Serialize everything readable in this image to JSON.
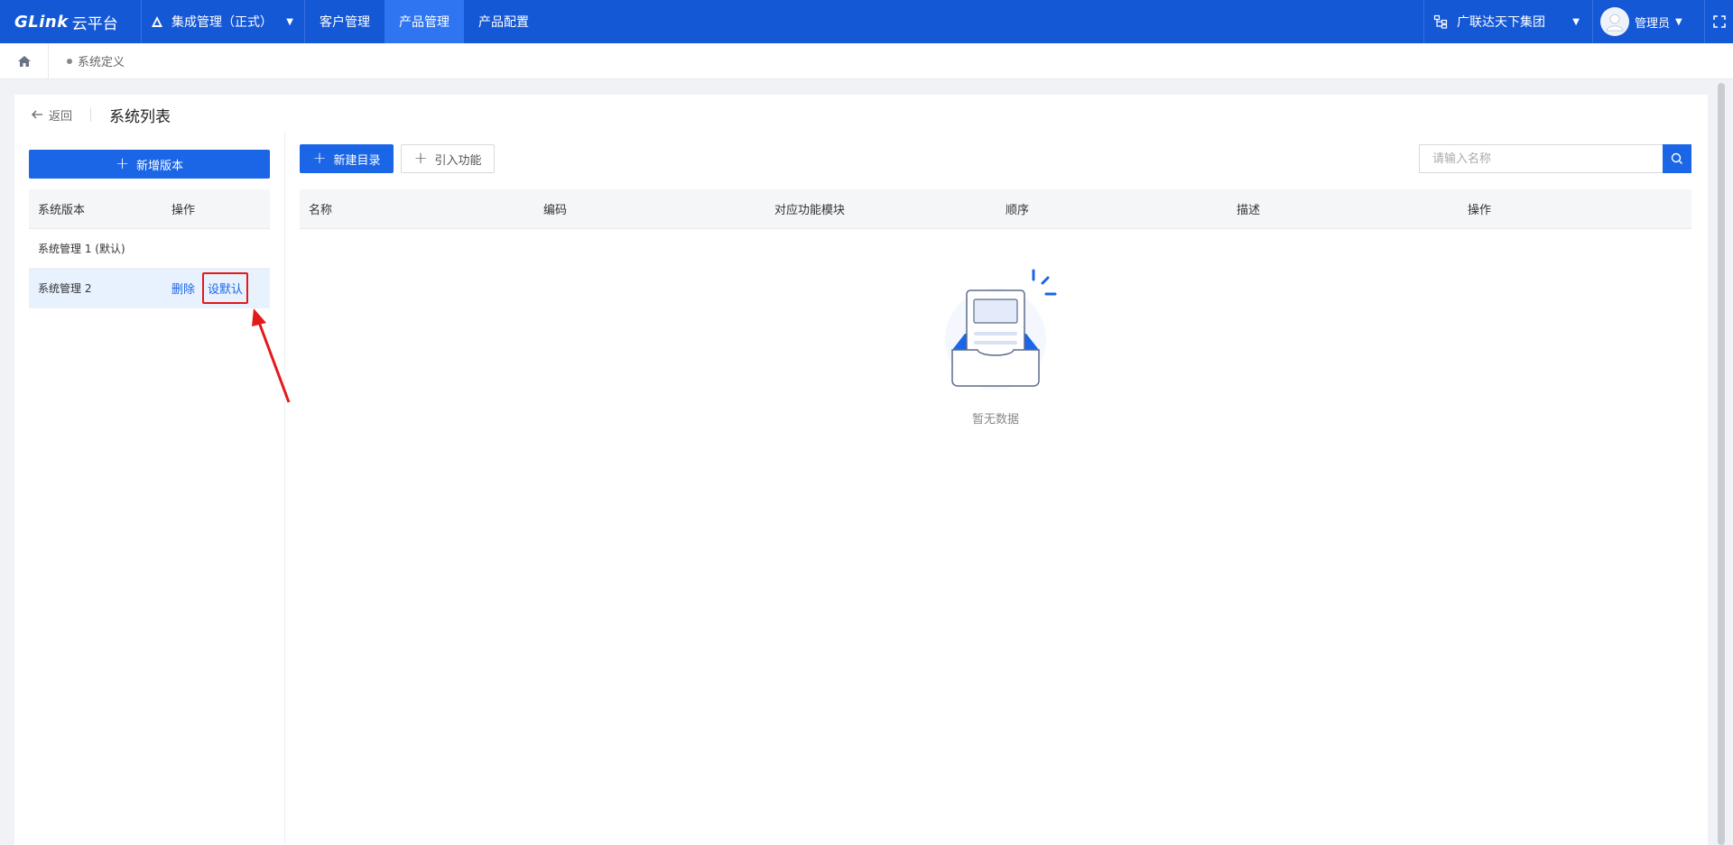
{
  "topbar": {
    "brand": "GLink",
    "brand_sub": "云平台",
    "system_switch": "集成管理（正式）",
    "nav": [
      "客户管理",
      "产品管理",
      "产品配置"
    ],
    "active_nav": "产品管理",
    "org": "广联达天下集团",
    "user": "管理员"
  },
  "breadcrumb": {
    "current": "系统定义"
  },
  "header": {
    "back": "返回",
    "title": "系统列表"
  },
  "left": {
    "add_button": "新增版本",
    "columns": [
      "系统版本",
      "操作"
    ],
    "rows": [
      {
        "name": "系统管理 1 (默认)",
        "ops": []
      },
      {
        "name": "系统管理 2",
        "ops": [
          "删除",
          "设默认"
        ]
      }
    ]
  },
  "right": {
    "new_dir_button": "新建目录",
    "import_button": "引入功能",
    "search_placeholder": "请输入名称",
    "columns": [
      "名称",
      "编码",
      "对应功能模块",
      "顺序",
      "描述",
      "操作"
    ],
    "empty_text": "暂无数据"
  },
  "colors": {
    "primary": "#1a66e6",
    "topbar": "#1558d6",
    "highlight": "#e21a1a"
  }
}
